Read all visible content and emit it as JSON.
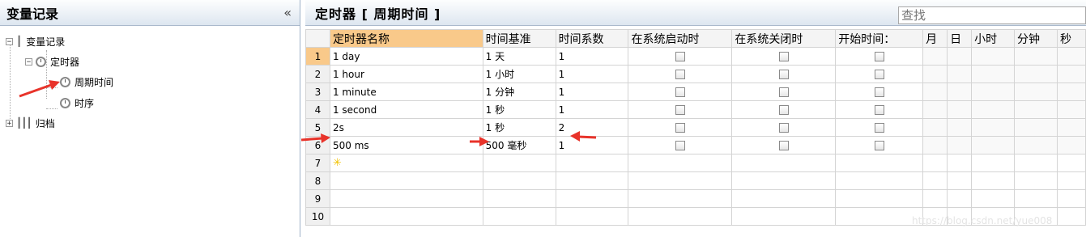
{
  "left_panel": {
    "title": "变量记录",
    "collapse_glyph": "«",
    "tree": {
      "root": {
        "toggle": "−",
        "label": "变量记录"
      },
      "timers": {
        "toggle": "−",
        "label": "定时器"
      },
      "period": {
        "label": "周期时间"
      },
      "sequence": {
        "label": "时序"
      },
      "archive": {
        "toggle": "+",
        "label": "归档"
      }
    }
  },
  "right_panel": {
    "title": "定时器  [  周期时间  ]",
    "search_placeholder": "查找"
  },
  "grid": {
    "columns": [
      "定时器名称",
      "时间基准",
      "时间系数",
      "在系统启动时",
      "在系统关闭时",
      "开始时间：",
      "月",
      "日",
      "小时",
      "分钟",
      "秒"
    ],
    "rows": [
      {
        "num": "1",
        "name": "1 day",
        "base": "1 天",
        "factor": "1",
        "on_start": false,
        "on_stop": false,
        "start_time": false
      },
      {
        "num": "2",
        "name": "1 hour",
        "base": "1 小时",
        "factor": "1",
        "on_start": false,
        "on_stop": false,
        "start_time": false
      },
      {
        "num": "3",
        "name": "1 minute",
        "base": "1 分钟",
        "factor": "1",
        "on_start": false,
        "on_stop": false,
        "start_time": false
      },
      {
        "num": "4",
        "name": "1 second",
        "base": "1 秒",
        "factor": "1",
        "on_start": false,
        "on_stop": false,
        "start_time": false
      },
      {
        "num": "5",
        "name": "2s",
        "base": "1 秒",
        "factor": "2",
        "on_start": false,
        "on_stop": false,
        "start_time": false
      },
      {
        "num": "6",
        "name": "500 ms",
        "base": "500 毫秒",
        "factor": "1",
        "on_start": false,
        "on_stop": false,
        "start_time": false
      }
    ],
    "empty_rows": [
      "7",
      "8",
      "9",
      "10"
    ],
    "new_row_icon": "new-row-star-icon"
  },
  "watermark": "https://blog.csdn.net/yue008",
  "colors": {
    "header_highlight": "#f9c98a",
    "arrow": "#e8332a"
  }
}
